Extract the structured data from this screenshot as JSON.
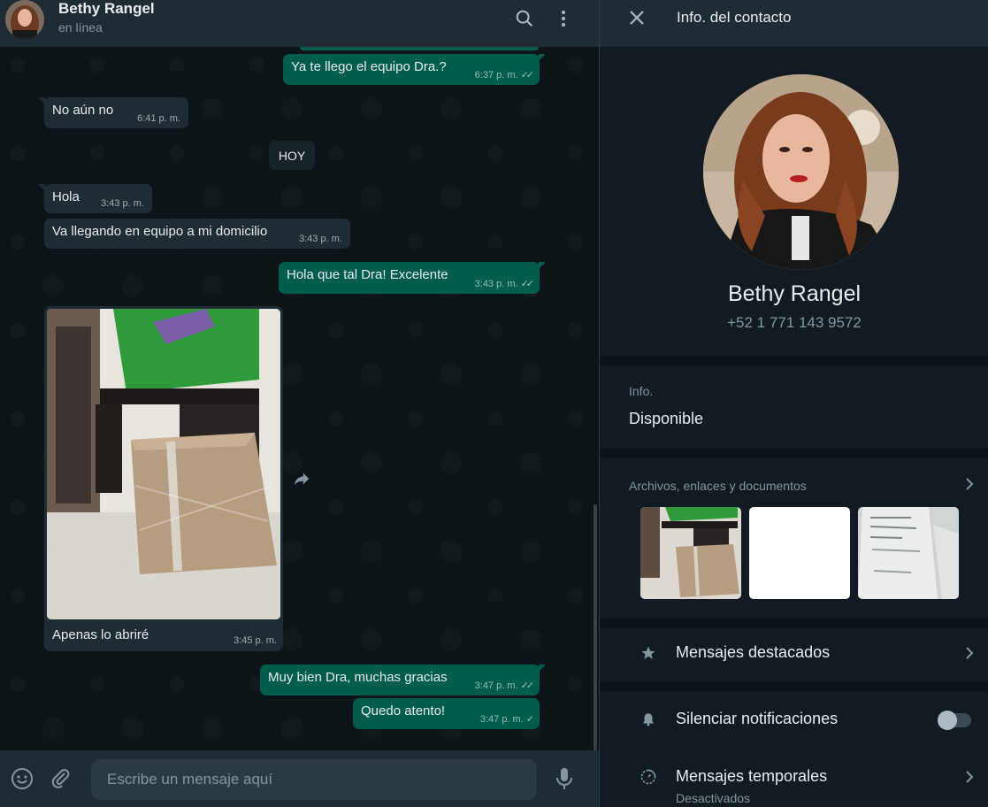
{
  "chat": {
    "contact_name": "Bethy Rangel",
    "status": "en línea",
    "composer_placeholder": "Escribe un mensaje aquí",
    "day_chip": "HOY",
    "messages": [
      {
        "dir": "out",
        "text": "Ya te llego el equipo Dra.?",
        "time": "6:37 p. m.",
        "ticks": "✓✓"
      },
      {
        "dir": "in",
        "text": "No aún no",
        "time": "6:41 p. m."
      },
      {
        "dir": "in",
        "text": "Hola",
        "time": "3:43 p. m."
      },
      {
        "dir": "in",
        "text": "Va llegando en equipo a mi domicilio",
        "time": "3:43 p. m."
      },
      {
        "dir": "out",
        "text": "Hola que tal Dra! Excelente",
        "time": "3:43 p. m.",
        "ticks": "✓✓"
      },
      {
        "dir": "in",
        "text": "Apenas lo abriré",
        "time": "3:45 p. m.",
        "has_image": true
      },
      {
        "dir": "out",
        "text": "Muy bien Dra, muchas gracias",
        "time": "3:47 p. m.",
        "ticks": "✓✓"
      },
      {
        "dir": "out",
        "text": "Quedo atento!",
        "time": "3:47 p. m.",
        "ticks": "✓"
      }
    ]
  },
  "info": {
    "title": "Info. del contacto",
    "name": "Bethy Rangel",
    "phone": "+52 1 771 143 9572",
    "about_label": "Info.",
    "about_value": "Disponible",
    "media_label": "Archivos, enlaces y documentos",
    "starred_label": "Mensajes destacados",
    "mute_label": "Silenciar notificaciones",
    "disappearing_label": "Mensajes temporales",
    "disappearing_value": "Desactivados"
  },
  "icons": [
    "search-icon",
    "menu-icon",
    "close-icon",
    "star-icon",
    "bell-icon",
    "timer-icon",
    "chevron-right-icon",
    "emoji-icon",
    "attach-icon",
    "mic-icon",
    "forward-icon"
  ],
  "colors": {
    "outgoing": "#005c4b",
    "incoming": "#202c33",
    "header": "#202c33",
    "panel": "#111b21"
  }
}
